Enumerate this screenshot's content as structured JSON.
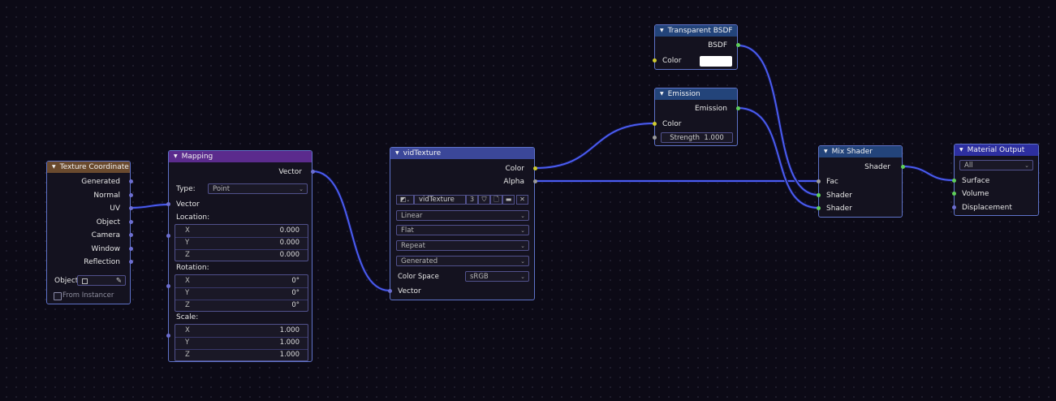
{
  "colors": {
    "vector_socket": "#6c6ed0",
    "color_socket": "#cfcb2e",
    "float_socket": "#9b9b9b",
    "shader_socket": "#5fcf5a",
    "wire": "#4a5cf0",
    "input_header": "#6a4a2e",
    "converter_header": "#5b2b8d",
    "texture_header": "#3b4799",
    "shader_header": "#23447a",
    "output_header": "#2d2fa0"
  },
  "texture_coordinate": {
    "title": "Texture Coordinate",
    "outputs": [
      "Generated",
      "Normal",
      "UV",
      "Object",
      "Camera",
      "Window",
      "Reflection"
    ],
    "object_label": "Object",
    "from_instancer": "From Instancer"
  },
  "mapping": {
    "title": "Mapping",
    "output": "Vector",
    "type_label": "Type:",
    "type_value": "Point",
    "vector_input": "Vector",
    "location": {
      "label": "Location:",
      "x": "0.000",
      "y": "0.000",
      "z": "0.000"
    },
    "rotation": {
      "label": "Rotation:",
      "x": "0°",
      "y": "0°",
      "z": "0°"
    },
    "scale": {
      "label": "Scale:",
      "x": "1.000",
      "y": "1.000",
      "z": "1.000"
    },
    "axis": {
      "x": "X",
      "y": "Y",
      "z": "Z"
    }
  },
  "image_texture": {
    "title": "vidTexture",
    "out_color": "Color",
    "out_alpha": "Alpha",
    "image_name": "vidTexture",
    "users": "3",
    "interpolation": "Linear",
    "projection": "Flat",
    "extension": "Repeat",
    "source": "Generated",
    "color_space_label": "Color Space",
    "color_space": "sRGB",
    "vector_input": "Vector"
  },
  "transparent_bsdf": {
    "title": "Transparent BSDF",
    "output": "BSDF",
    "color_label": "Color"
  },
  "emission": {
    "title": "Emission",
    "output": "Emission",
    "color_label": "Color",
    "strength_label": "Strength",
    "strength_value": "1.000"
  },
  "mix_shader": {
    "title": "Mix Shader",
    "output": "Shader",
    "fac": "Fac",
    "shader1": "Shader",
    "shader2": "Shader"
  },
  "material_output": {
    "title": "Material Output",
    "target": "All",
    "surface": "Surface",
    "volume": "Volume",
    "displacement": "Displacement"
  }
}
